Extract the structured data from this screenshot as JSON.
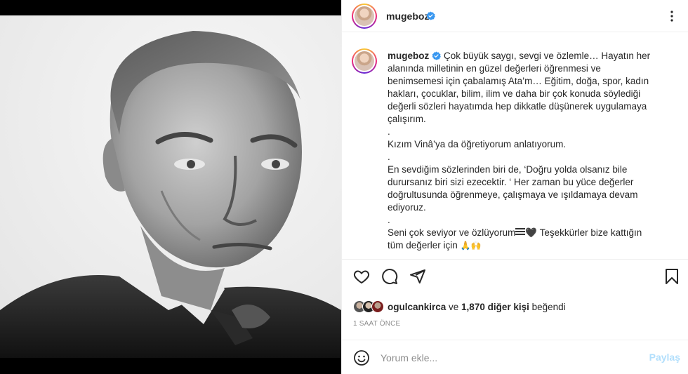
{
  "post": {
    "author": "mugeboz",
    "caption_lines": [
      "Çok büyük saygı, sevgi ve özlemle… Hayatın her",
      "alanında milletinin en güzel değerleri öğrenmesi ve",
      "benimsemesi için çabalamış Ata’m… Eğitim, doğa, spor, kadın",
      "hakları, çocuklar, bilim, ilim ve daha bir çok konuda söylediği",
      "değerli sözleri hayatımda hep dikkatle düşünerek uygulamaya",
      "çalışırım.",
      ".",
      "Kızım Vinâ’ya da öğretiyorum anlatıyorum.",
      ".",
      "En sevdiğim sözlerinden biri de, ‘Doğru yolda olsanız bile",
      "durursanız biri sizi ezecektir. ‘ Her zaman bu yüce değerler",
      "doğrultusunda öğrenmeye, çalışmaya ve ışıldamaya devam",
      "ediyoruz.",
      "."
    ],
    "caption_tail_1": "Seni çok seviyor ve özlüyorum",
    "caption_heart": "🖤",
    "caption_tail_2": " Teşekkürler bize kattığın",
    "caption_tail_3": "tüm değerler için ",
    "caption_emoji": "🙏🙌",
    "likes_user": "ogulcankirca",
    "likes_mid": " ve ",
    "likes_count": "1,870 diğer kişi",
    "likes_end": " beğendi",
    "time": "1 SAAT ÖNCE",
    "comment_placeholder": "Yorum ekle...",
    "post_button": "Paylaş"
  },
  "icons": {
    "like": "heart-icon",
    "comment": "comment-icon",
    "share": "share-icon",
    "save": "bookmark-icon",
    "more": "more-icon",
    "emoji": "emoji-icon",
    "verified": "verified-badge-icon"
  },
  "colors": {
    "verified": "#3897f0",
    "post_button_disabled": "#b2dffc",
    "meta_gray": "#8e8e8e"
  }
}
